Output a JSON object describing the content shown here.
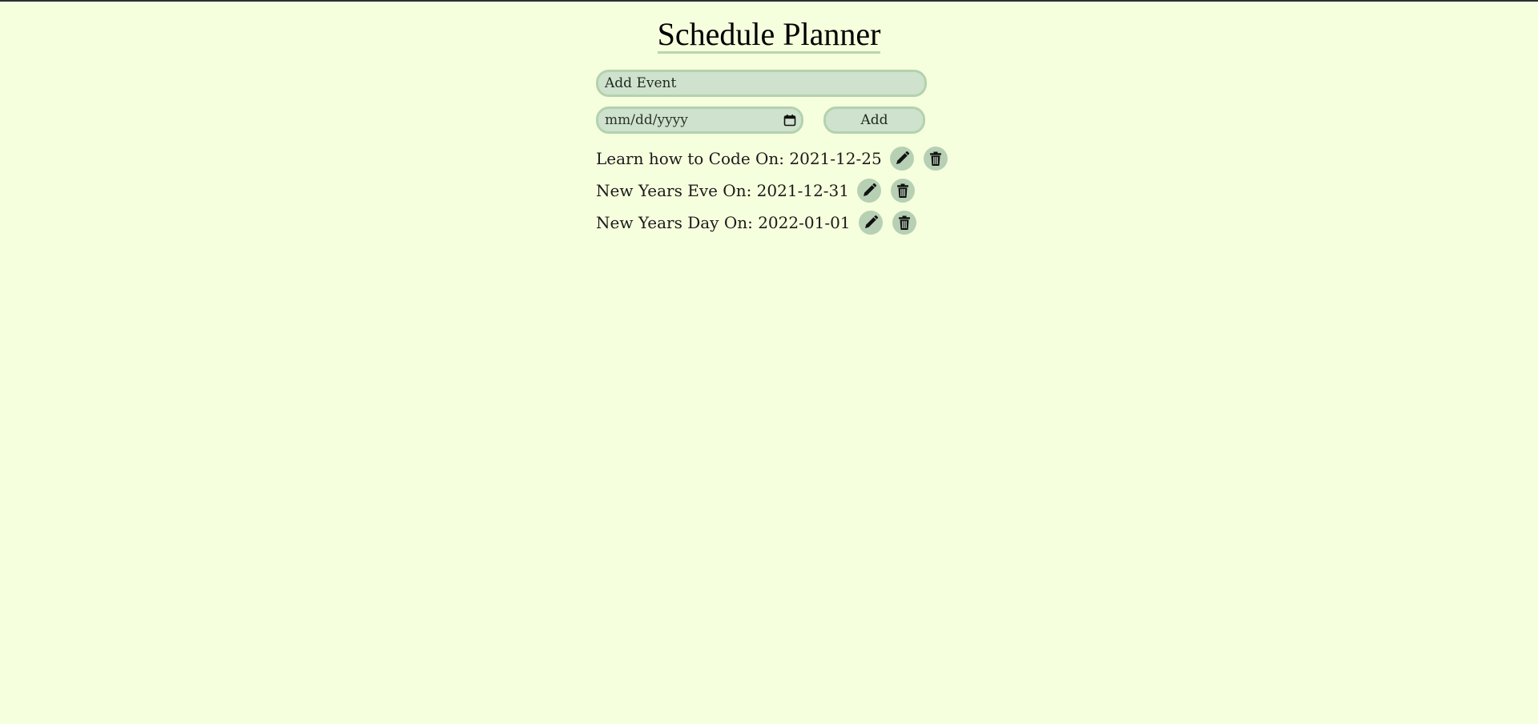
{
  "title": "Schedule Planner",
  "event_input": {
    "placeholder": "Add Event"
  },
  "date_input": {
    "placeholder": "mm/dd/yyyy",
    "icon": "calendar-icon"
  },
  "add_button": {
    "label": "Add"
  },
  "events": [
    {
      "text": "Learn how to Code On: 2021-12-25",
      "edit_icon": "pencil-icon",
      "delete_icon": "trash-icon"
    },
    {
      "text": "New Years Eve On: 2021-12-31",
      "edit_icon": "pencil-icon",
      "delete_icon": "trash-icon"
    },
    {
      "text": "New Years Day On: 2022-01-01",
      "edit_icon": "pencil-icon",
      "delete_icon": "trash-icon"
    }
  ],
  "colors": {
    "background": "#f6ffdd",
    "field_fill": "#cfe2cd",
    "field_border": "#b3d2ad",
    "icon_button_fill": "#b7d0b4"
  }
}
